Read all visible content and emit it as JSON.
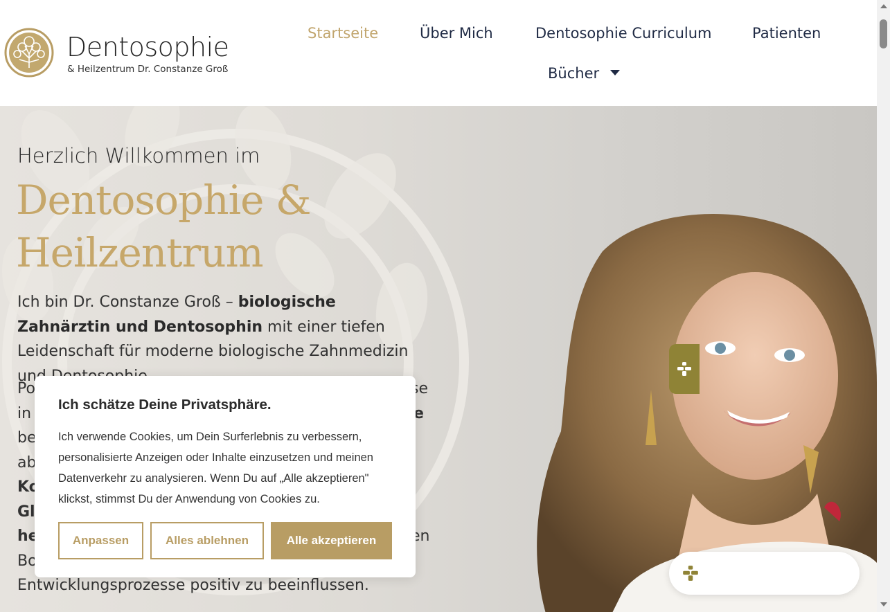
{
  "brand": {
    "name": "Dentosophie",
    "subtitle": "& Heilzentrum Dr. Constanze Groß",
    "accent": "#c1a56d"
  },
  "nav": {
    "items": [
      {
        "label": "Startseite"
      },
      {
        "label": "Über Mich"
      },
      {
        "label": "Dentosophie Curriculum"
      },
      {
        "label": "Patienten"
      },
      {
        "label": "Bücher"
      }
    ]
  },
  "hero": {
    "kicker": "Herzlich Willkommen im",
    "title_line1": "Dentosophie &",
    "title_line2": "Heilzentrum",
    "intro_part1": "Ich bin Dr. Constanze Groß – ",
    "intro_bold": "biologische Zahnärztin und Dentosophin",
    "intro_part2": " mit einer tiefen Leidenschaft für moderne biologische Zahnmedizin und Dentosophie.",
    "para2_lines": [
      {
        "text": "Po",
        "bold": false,
        "right": "se"
      },
      {
        "text": "in",
        "bold": false,
        "right": "e"
      },
      {
        "text": "be",
        "bold": false,
        "right": ""
      },
      {
        "text": "ab",
        "bold": false,
        "right": ""
      },
      {
        "text": "Ko",
        "bold": true,
        "right": ""
      },
      {
        "text": "Gl",
        "bold": true,
        "right": ""
      },
      {
        "text": "he",
        "bold": true,
        "right": "en"
      },
      {
        "text": "Bo",
        "bold": false,
        "right": ""
      },
      {
        "text": "Entwicklungsprozesse positiv zu beeinflussen.",
        "bold": false,
        "right": ""
      }
    ]
  },
  "cookie": {
    "title": "Ich schätze Deine Privatsphäre.",
    "text": "Ich verwende Cookies, um Dein Surferlebnis zu verbessern, personalisierte Anzeigen oder Inhalte einzusetzen und meinen Datenverkehr zu analysieren. Wenn Du auf „Alle akzeptieren\" klickst, stimmst Du der Anwendung von Cookies zu.",
    "btn_customize": "Anpassen",
    "btn_reject": "Alles ablehnen",
    "btn_accept": "Alle akzeptieren",
    "button_color": "#b89d64"
  },
  "widgets": {
    "a11y_tab_color": "#8f8336",
    "icon": "accessibility-icon"
  }
}
